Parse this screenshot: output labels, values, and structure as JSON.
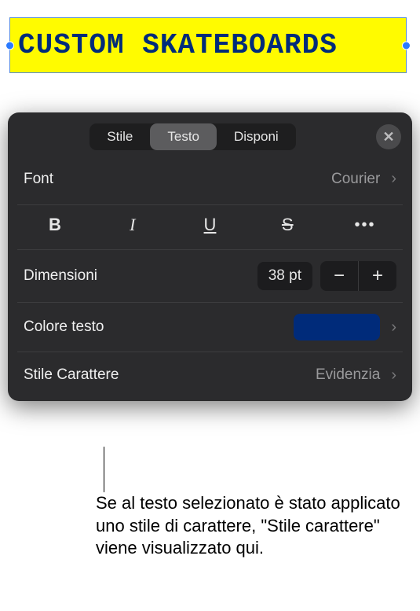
{
  "canvas": {
    "sample_text": "CUSTOM SKATEBOARDS"
  },
  "panel": {
    "tabs": {
      "style": "Stile",
      "text": "Testo",
      "arrange": "Disponi"
    },
    "font": {
      "label": "Font",
      "value": "Courier"
    },
    "style_buttons": {
      "bold": "B",
      "italic": "I",
      "underline": "U",
      "strike": "S",
      "more": "•••"
    },
    "size": {
      "label": "Dimensioni",
      "value": "38 pt",
      "minus": "−",
      "plus": "+"
    },
    "color": {
      "label": "Colore testo",
      "hex": "#002b7a"
    },
    "char_style": {
      "label": "Stile Carattere",
      "value": "Evidenzia"
    }
  },
  "callout": {
    "text": "Se al testo selezionato è stato applicato uno stile di carattere, \"Stile carattere\" viene visualizzato qui."
  }
}
